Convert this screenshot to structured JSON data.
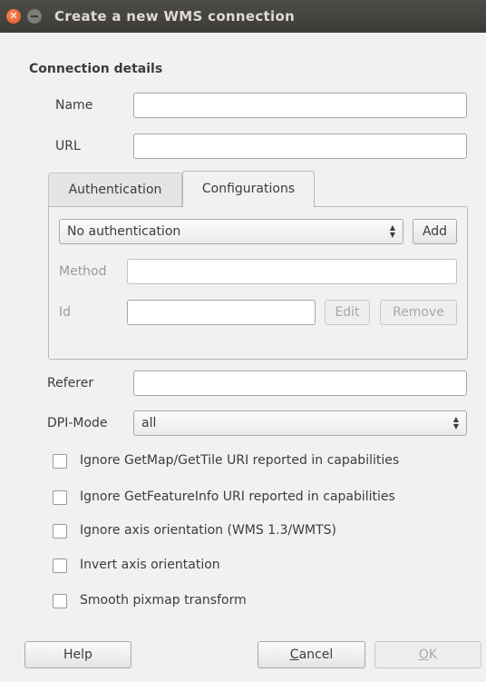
{
  "window": {
    "title": "Create a new WMS connection",
    "close_glyph": "✕"
  },
  "section_title": "Connection details",
  "fields": {
    "name_label": "Name",
    "name_value": "",
    "url_label": "URL",
    "url_value": "",
    "referer_label": "Referer",
    "referer_value": "",
    "dpi_label": "DPI-Mode",
    "dpi_value": "all"
  },
  "tabs": [
    {
      "label": "Authentication",
      "active": false
    },
    {
      "label": "Configurations",
      "active": true
    }
  ],
  "auth": {
    "combo_value": "No authentication",
    "add_label": "Add",
    "method_label": "Method",
    "method_value": "",
    "id_label": "Id",
    "id_value": "",
    "edit_label": "Edit",
    "remove_label": "Remove"
  },
  "checkboxes": [
    {
      "label": "Ignore GetMap/GetTile URI reported in capabilities",
      "checked": false
    },
    {
      "label": "Ignore GetFeatureInfo URI reported in capabilities",
      "checked": false
    },
    {
      "label": "Ignore axis orientation (WMS 1.3/WMTS)",
      "checked": false
    },
    {
      "label": "Invert axis orientation",
      "checked": false
    },
    {
      "label": "Smooth pixmap transform",
      "checked": false
    }
  ],
  "buttons": {
    "help": "Help",
    "cancel_pre": "",
    "cancel_key": "C",
    "cancel_post": "ancel",
    "ok_key": "O",
    "ok_post": "K"
  },
  "spin_glyphs": {
    "up": "▲",
    "down": "▼"
  }
}
